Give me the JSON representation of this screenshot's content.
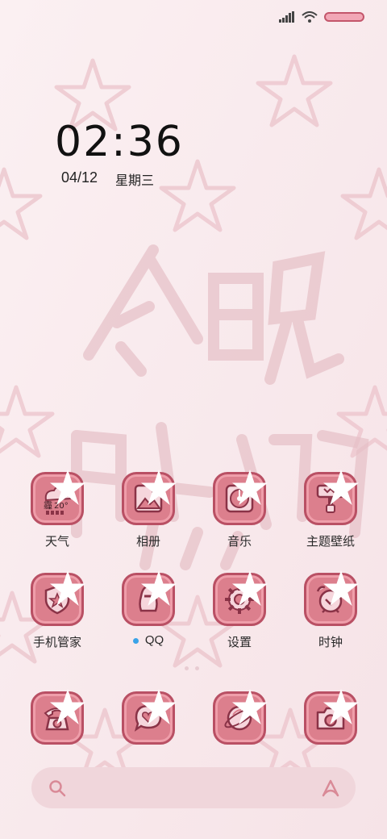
{
  "status_bar": {
    "battery_color": "#f2a7b6"
  },
  "lock": {
    "time": "02:36",
    "date": "04/12",
    "weekday": "星期三"
  },
  "wallpaper": {
    "calligraphy": "今晚早点睡"
  },
  "apps": [
    {
      "label": "天气",
      "icon": "weather-icon",
      "temperature": "20°",
      "condition": "霾"
    },
    {
      "label": "相册",
      "icon": "gallery-icon"
    },
    {
      "label": "音乐",
      "icon": "music-icon"
    },
    {
      "label": "主题壁纸",
      "icon": "theme-icon"
    },
    {
      "label": "手机管家",
      "icon": "shield-icon"
    },
    {
      "label": "QQ",
      "icon": "qq-penguin-icon",
      "has_notification_dot": true
    },
    {
      "label": "设置",
      "icon": "gear-icon"
    },
    {
      "label": "时钟",
      "icon": "alarm-clock-icon"
    }
  ],
  "dock": [
    {
      "icon": "phone-icon"
    },
    {
      "icon": "message-icon"
    },
    {
      "icon": "browser-icon"
    },
    {
      "icon": "camera-icon"
    }
  ],
  "search": {
    "icon": "search-icon",
    "assistant_icon": "assistant-icon"
  },
  "colors": {
    "tile": "#dc7f8d",
    "tile_border": "#b95064",
    "accent_dot": "#3aa3e8"
  }
}
